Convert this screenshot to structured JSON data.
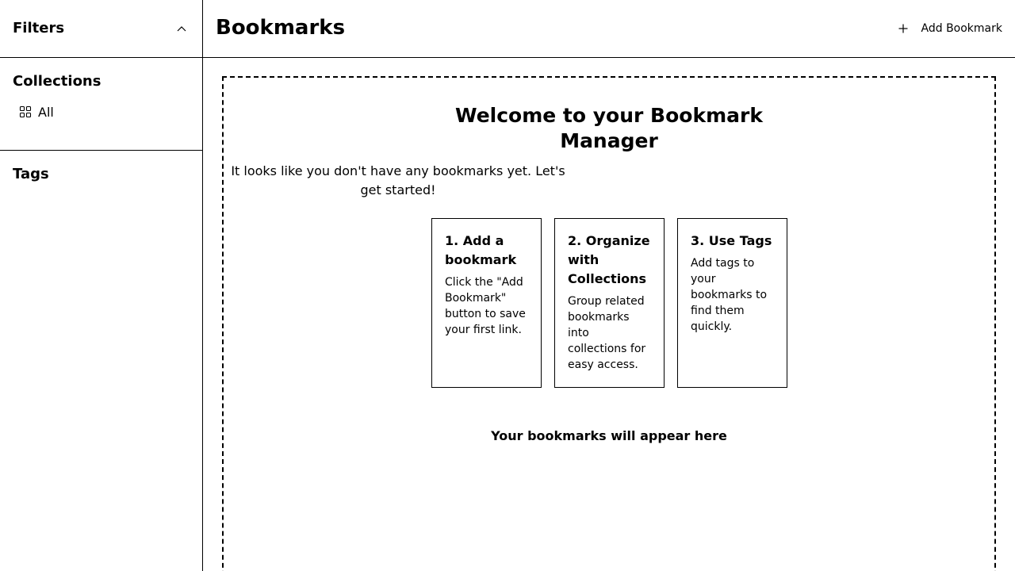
{
  "sidebar": {
    "filters_title": "Filters",
    "collapse_icon": "chevron-up-icon",
    "collections_title": "Collections",
    "collections": [
      {
        "label": "All",
        "icon": "grid-icon"
      }
    ],
    "tags_title": "Tags"
  },
  "header": {
    "title": "Bookmarks",
    "add_button_label": "Add Bookmark",
    "add_button_icon": "plus-icon"
  },
  "empty_state": {
    "title": "Welcome to your Bookmark Manager",
    "subtitle": "It looks like you don't have any bookmarks yet. Let's get started!",
    "steps": [
      {
        "title": "1. Add a bookmark",
        "description": "Click the \"Add Bookmark\" button to save your first link."
      },
      {
        "title": "2. Organize with Collections",
        "description": "Group related bookmarks into collections for easy access."
      },
      {
        "title": "3. Use Tags",
        "description": "Add tags to your bookmarks to find them quickly."
      }
    ],
    "placeholder": "Your bookmarks will appear here"
  }
}
